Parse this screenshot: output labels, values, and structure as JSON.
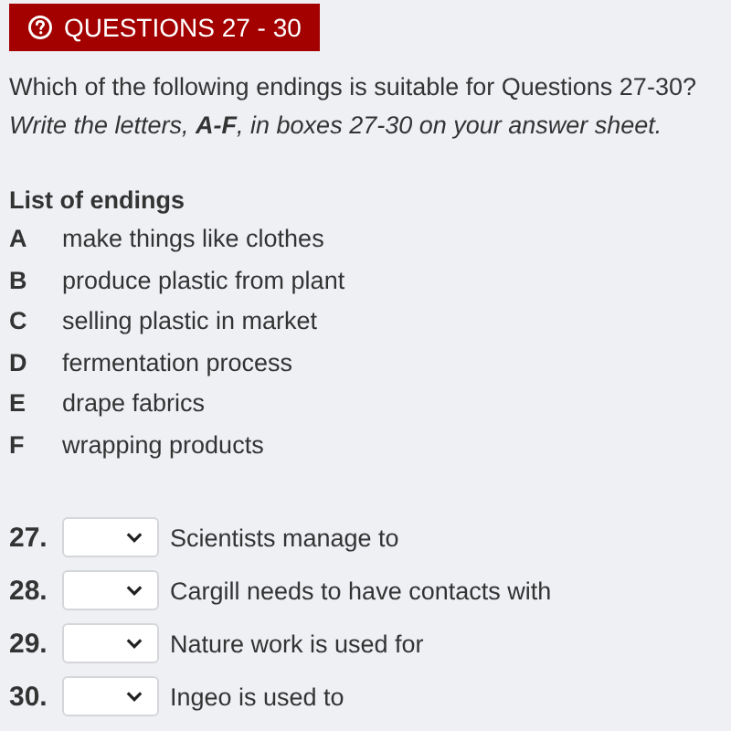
{
  "header": {
    "title": "QUESTIONS 27 - 30"
  },
  "question": "Which of the following endings is suitable for Questions 27-30?",
  "instruction": "Write the letters, **A-F**, in boxes 27-30 on your answer sheet.",
  "endings": {
    "title": "List of endings",
    "items": [
      {
        "letter": "A",
        "text": "make things like clothes"
      },
      {
        "letter": "B",
        "text": "produce plastic from plant"
      },
      {
        "letter": "C",
        "text": "selling plastic in market"
      },
      {
        "letter": "D",
        "text": "fermentation process"
      },
      {
        "letter": "E",
        "text": "drape fabrics"
      },
      {
        "letter": "F",
        "text": "wrapping products"
      }
    ]
  },
  "questions": [
    {
      "number": "27.",
      "text": "Scientists manage to"
    },
    {
      "number": "28.",
      "text": "Cargill needs to have contacts with"
    },
    {
      "number": "29.",
      "text": "Nature work is used for"
    },
    {
      "number": "30.",
      "text": "Ingeo is used to"
    }
  ]
}
